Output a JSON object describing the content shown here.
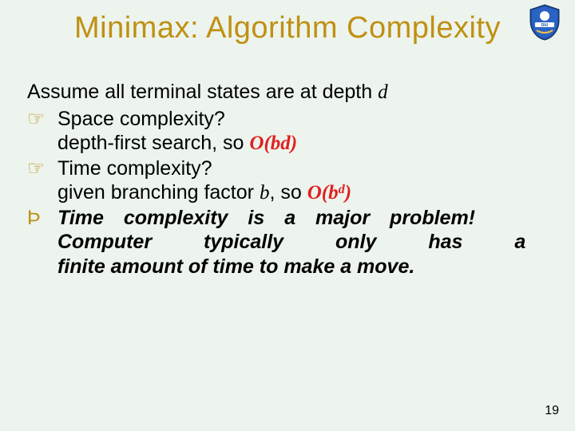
{
  "slide": {
    "title": "Minimax: Algorithm Complexity",
    "page_number": "19",
    "logo_text": "DIU"
  },
  "content": {
    "intro_prefix": "Assume all terminal states are at depth ",
    "intro_var": "d",
    "point1_q": "Space complexity?",
    "point1_a_prefix": "depth-first search, so ",
    "point1_a_bigO": "O(bd)",
    "point2_q": "Time complexity?",
    "point2_a_prefix": "given branching factor ",
    "point2_a_var": "b",
    "point2_a_mid": ", so ",
    "point2_a_bigO_base": "O(b",
    "point2_a_bigO_sup": "d",
    "point2_a_bigO_close": ")",
    "conclusion_l1": "Time complexity is a major problem!",
    "conclusion_l2": "Computer typically only has a",
    "conclusion_l3": "finite amount of time to make a move."
  },
  "icons": {
    "hand": "☞",
    "club": "Þ"
  },
  "colors": {
    "accent": "#c09012",
    "bigO": "#e02020",
    "bg": "#ecf4ed"
  }
}
